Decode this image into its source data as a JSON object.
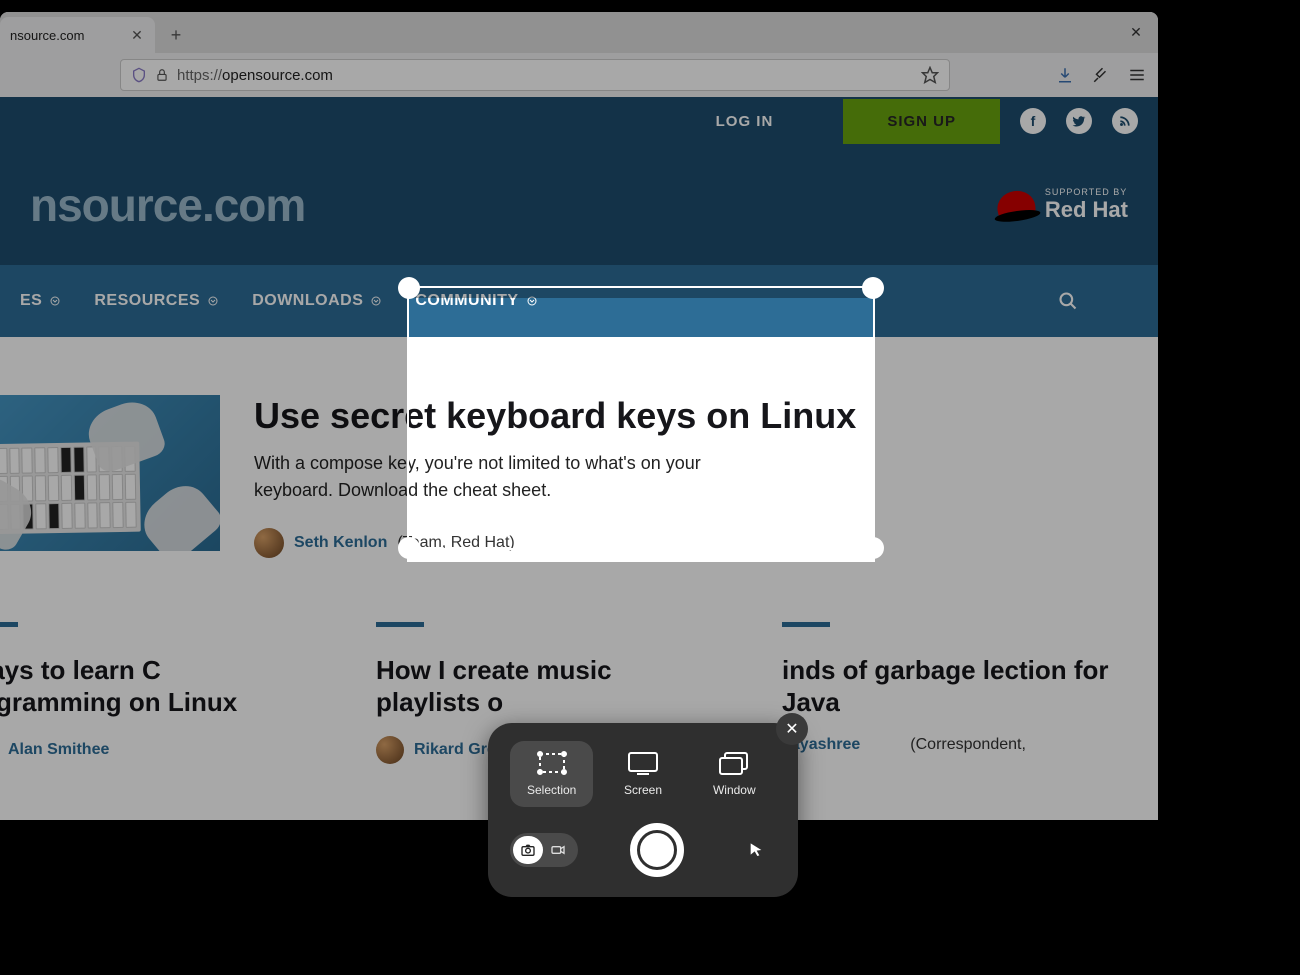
{
  "browser": {
    "tab_title": "nsource.com",
    "url_display_prefix": "https://",
    "url_display_domain": "opensource.com",
    "url_full": "https://opensource.com"
  },
  "header": {
    "login": "LOG IN",
    "signup": "SIGN UP",
    "brand": "nsource.com",
    "redhat_sup": "SUPPORTED BY",
    "redhat_main": "Red Hat"
  },
  "nav": {
    "items": [
      "ES",
      "RESOURCES",
      "DOWNLOADS",
      "COMMUNITY"
    ]
  },
  "hero": {
    "title": "Use secret keyboard keys on Linux",
    "desc": "With a compose key, you're not limited to what's on your keyboard. Download the cheat sheet.",
    "author": "Seth Kenlon",
    "author_role": "(Team, Red Hat)"
  },
  "articles": [
    {
      "title": "ways to learn C rogramming on Linux",
      "author": "Alan Smithee",
      "role": ""
    },
    {
      "title": "How I create music playlists o",
      "author": "Rikard Gro",
      "role": ""
    },
    {
      "title": "inds of garbage lection for Java",
      "author": "Jayashree",
      "role": "(Correspondent,"
    }
  ],
  "screenshot": {
    "modes": {
      "selection": "Selection",
      "screen": "Screen",
      "window": "Window"
    }
  }
}
